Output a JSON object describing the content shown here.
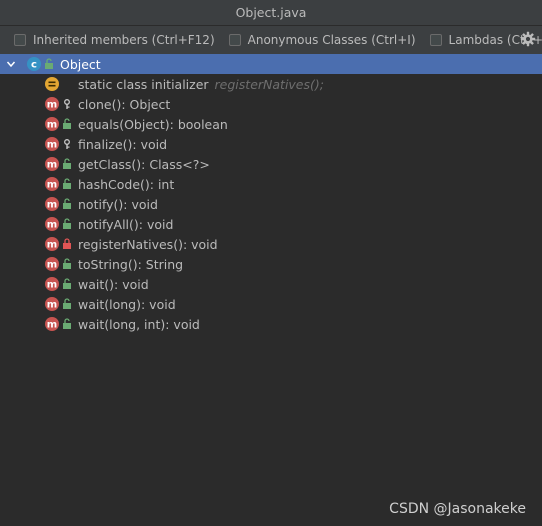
{
  "window": {
    "title": "Object.java"
  },
  "toolbar": {
    "options": [
      {
        "label": "Inherited members (Ctrl+F12)",
        "checked": false
      },
      {
        "label": "Anonymous Classes (Ctrl+I)",
        "checked": false
      },
      {
        "label": "Lambdas (Ctrl+L)",
        "checked": false
      }
    ],
    "settings_icon": "gear-icon"
  },
  "tree": {
    "root": {
      "label": "Object",
      "icon": "class-icon",
      "visibility": "public",
      "expanded": true
    },
    "members": [
      {
        "label": "static class initializer",
        "hint": "registerNatives();",
        "icon": "static-initializer-icon",
        "visibility": "none"
      },
      {
        "label": "clone(): Object",
        "icon": "method-icon",
        "visibility": "protected"
      },
      {
        "label": "equals(Object): boolean",
        "icon": "method-icon",
        "visibility": "public"
      },
      {
        "label": "finalize(): void",
        "icon": "method-icon",
        "visibility": "protected"
      },
      {
        "label": "getClass(): Class<?>",
        "icon": "method-icon",
        "visibility": "public"
      },
      {
        "label": "hashCode(): int",
        "icon": "method-icon",
        "visibility": "public"
      },
      {
        "label": "notify(): void",
        "icon": "method-icon",
        "visibility": "public"
      },
      {
        "label": "notifyAll(): void",
        "icon": "method-icon",
        "visibility": "public"
      },
      {
        "label": "registerNatives(): void",
        "icon": "method-icon",
        "visibility": "private"
      },
      {
        "label": "toString(): String",
        "icon": "method-icon",
        "visibility": "public"
      },
      {
        "label": "wait(): void",
        "icon": "method-icon",
        "visibility": "public"
      },
      {
        "label": "wait(long): void",
        "icon": "method-icon",
        "visibility": "public"
      },
      {
        "label": "wait(long, int): void",
        "icon": "method-icon",
        "visibility": "public"
      }
    ]
  },
  "watermark": "CSDN @Jasonakeke",
  "colors": {
    "background": "#2b2b2b",
    "selection": "#4b6eaf",
    "method_icon": "#c75450",
    "class_icon": "#3592c4",
    "initializer_icon": "#e3a633",
    "public": "#6aab73",
    "private": "#e05555",
    "protected": "#c9c9c9"
  }
}
